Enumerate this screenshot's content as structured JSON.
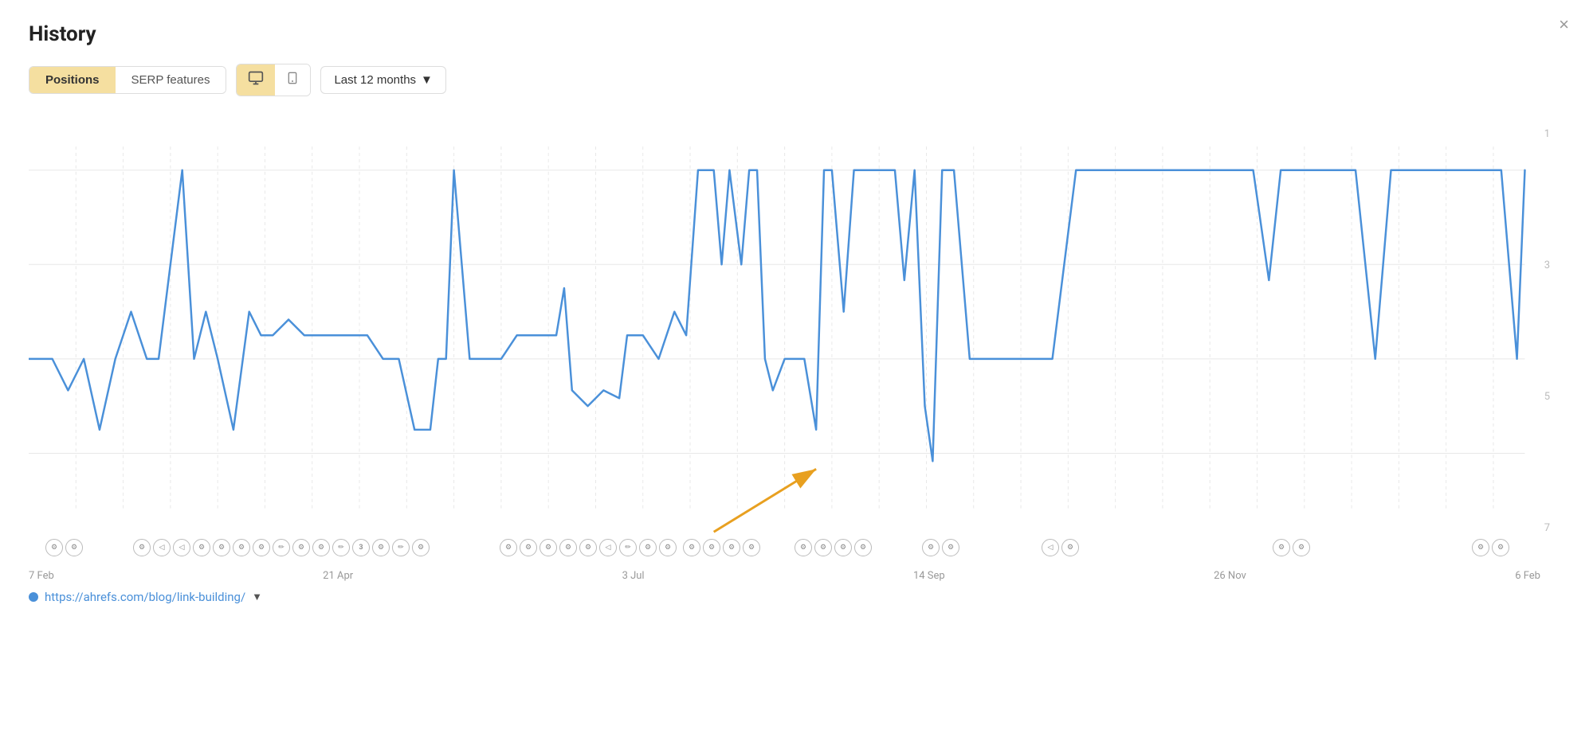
{
  "title": "History",
  "close_label": "×",
  "toolbar": {
    "tabs": [
      {
        "label": "Positions",
        "active": true
      },
      {
        "label": "SERP features",
        "active": false
      }
    ],
    "devices": [
      {
        "label": "desktop",
        "unicode": "🖥",
        "active": true
      },
      {
        "label": "mobile",
        "unicode": "📱",
        "active": false
      }
    ],
    "date_range": {
      "label": "Last 12 months",
      "arrow": "▼"
    }
  },
  "chart": {
    "y_labels": [
      "1",
      "3",
      "5",
      "7"
    ],
    "x_labels": [
      "7 Feb",
      "21 Apr",
      "3 Jul",
      "14 Sep",
      "26 Nov",
      "6 Feb"
    ]
  },
  "url": {
    "href": "https://ahrefs.com/blog/link-building/",
    "arrow": "▼"
  }
}
